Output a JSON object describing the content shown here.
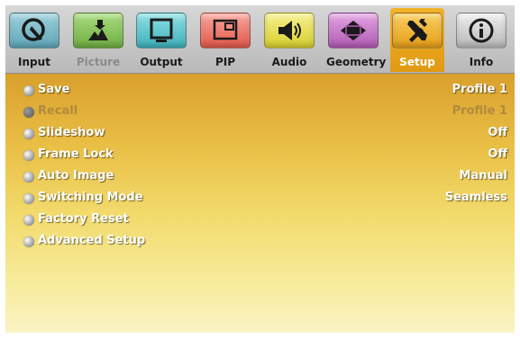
{
  "colors": {
    "tab_input": "#6fb3c4",
    "tab_picture": "#86c45a",
    "tab_output": "#5cc3cc",
    "tab_pip": "#ef7a6e",
    "tab_audio": "#ece35a",
    "tab_geometry": "#c87ac8",
    "tab_setup": "#f1b02c",
    "tab_info": "#d2d2d2",
    "active_tab": "#e9a51d",
    "panel_top": "#d99f2c",
    "panel_bottom": "#faf3c4"
  },
  "tabs": [
    {
      "label": "Input",
      "icon": "input-icon"
    },
    {
      "label": "Picture",
      "icon": "picture-icon"
    },
    {
      "label": "Output",
      "icon": "output-icon"
    },
    {
      "label": "PIP",
      "icon": "pip-icon"
    },
    {
      "label": "Audio",
      "icon": "audio-icon"
    },
    {
      "label": "Geometry",
      "icon": "geometry-icon"
    },
    {
      "label": "Setup",
      "icon": "setup-icon"
    },
    {
      "label": "Info",
      "icon": "info-icon"
    }
  ],
  "menu": [
    {
      "name": "Save",
      "value": "Profile 1"
    },
    {
      "name": "Recall",
      "value": "Profile 1"
    },
    {
      "name": "Slideshow",
      "value": "Off"
    },
    {
      "name": "Frame Lock",
      "value": "Off"
    },
    {
      "name": "Auto Image",
      "value": "Manual"
    },
    {
      "name": "Switching Mode",
      "value": "Seamless"
    },
    {
      "name": "Factory Reset",
      "value": ""
    },
    {
      "name": "Advanced Setup",
      "value": ""
    }
  ]
}
